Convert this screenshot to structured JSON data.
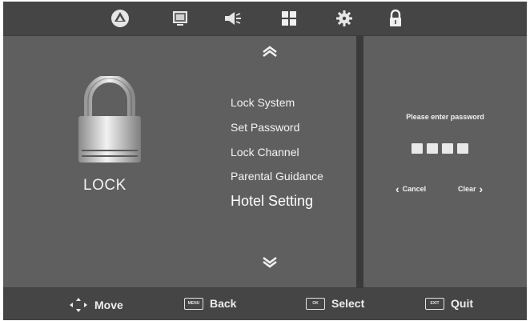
{
  "menu_tabs": [
    {
      "name": "picture-tab",
      "icon": "triangle-circle-icon"
    },
    {
      "name": "channel-tab",
      "icon": "monitor-icon"
    },
    {
      "name": "sound-tab",
      "icon": "speaker-icon"
    },
    {
      "name": "time-tab",
      "icon": "grid-icon"
    },
    {
      "name": "setup-tab",
      "icon": "gear-icon"
    },
    {
      "name": "lock-tab",
      "icon": "padlock-icon",
      "active": true
    }
  ],
  "page": {
    "title": "LOCK",
    "icon": "padlock-icon"
  },
  "menu_items": [
    {
      "label": "Lock System"
    },
    {
      "label": "Set Password"
    },
    {
      "label": "Lock Channel"
    },
    {
      "label": "Parental Guidance"
    },
    {
      "label": "Hotel Setting",
      "selected": true
    }
  ],
  "password_panel": {
    "prompt": "Please enter password",
    "digit_count": 4,
    "cancel_label": "Cancel",
    "clear_label": "Clear"
  },
  "footer": {
    "move_label": "Move",
    "back_label": "Back",
    "back_key": "MENU",
    "select_label": "Select",
    "select_key": "OK",
    "quit_label": "Quit",
    "quit_key": "EXIT"
  },
  "colors": {
    "bar_bg": "#454545",
    "panel_bg": "#5f5f5f",
    "text": "#f4f4f4"
  }
}
